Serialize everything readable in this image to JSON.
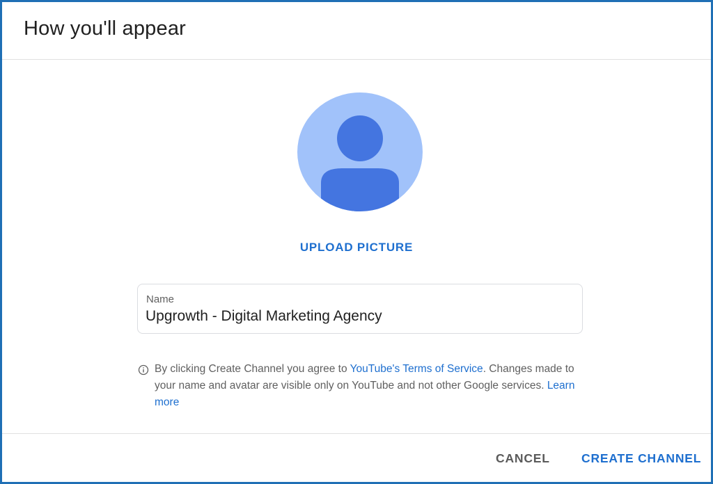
{
  "dialog": {
    "title": "How you'll appear"
  },
  "avatar": {
    "icon": "person-avatar-icon",
    "background_color": "#a1c2fa",
    "figure_color": "#4475e0"
  },
  "upload": {
    "label": "UPLOAD PICTURE"
  },
  "name_field": {
    "label": "Name",
    "value": "Upgrowth - Digital Marketing Agency"
  },
  "notice": {
    "icon": "info-icon",
    "text_before": "By clicking Create Channel you agree to ",
    "terms_link": "YouTube's Terms of Service",
    "text_after": ". Changes made to your name and avatar are visible only on YouTube and not other Google services. ",
    "learn_more_link": "Learn more"
  },
  "actions": {
    "cancel_label": "CANCEL",
    "create_label": "CREATE CHANNEL"
  },
  "colors": {
    "accent": "#1e6fcf",
    "border": "#1f6fb5"
  }
}
